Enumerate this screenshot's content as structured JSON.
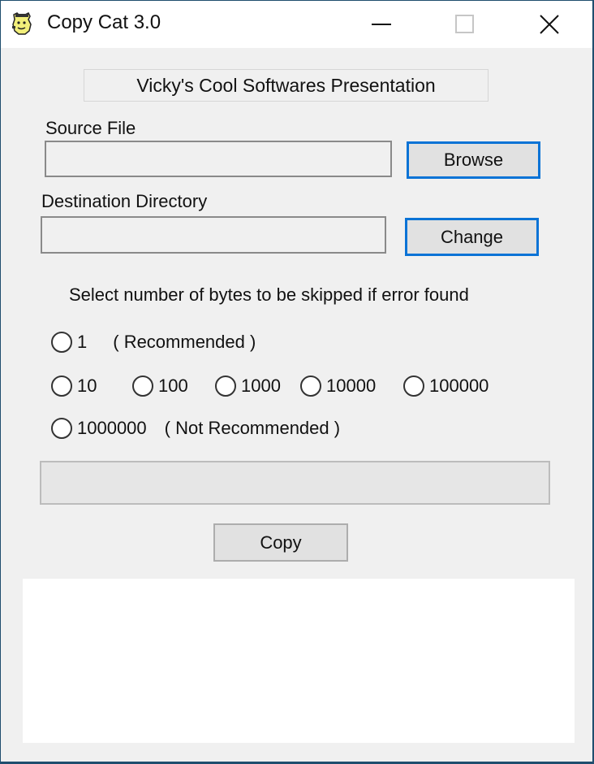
{
  "window": {
    "title": "Copy Cat 3.0",
    "icon": "cat-app-icon",
    "controls": {
      "minimize": "minimize-icon",
      "maximize": "maximize-icon",
      "close": "close-icon"
    }
  },
  "header": {
    "text": "Vicky's Cool Softwares Presentation"
  },
  "source": {
    "label": "Source File",
    "value": "",
    "button": "Browse"
  },
  "destination": {
    "label": "Destination Directory",
    "value": "",
    "button": "Change"
  },
  "skip": {
    "prompt": "Select number of bytes to be skipped if error found",
    "options": [
      {
        "value": "1",
        "note": "( Recommended )",
        "selected": false
      },
      {
        "value": "10",
        "selected": false
      },
      {
        "value": "100",
        "selected": false
      },
      {
        "value": "1000",
        "selected": false
      },
      {
        "value": "10000",
        "selected": false
      },
      {
        "value": "100000",
        "selected": false
      },
      {
        "value": "1000000",
        "note": "( Not Recommended )",
        "selected": false
      }
    ]
  },
  "progress": {
    "value_percent": 0
  },
  "actions": {
    "copy": "Copy"
  },
  "log": {
    "text": ""
  },
  "colors": {
    "focus_border": "#0a73d6",
    "window_bg": "#f0f0f0",
    "frame": "#1f4e6e"
  }
}
